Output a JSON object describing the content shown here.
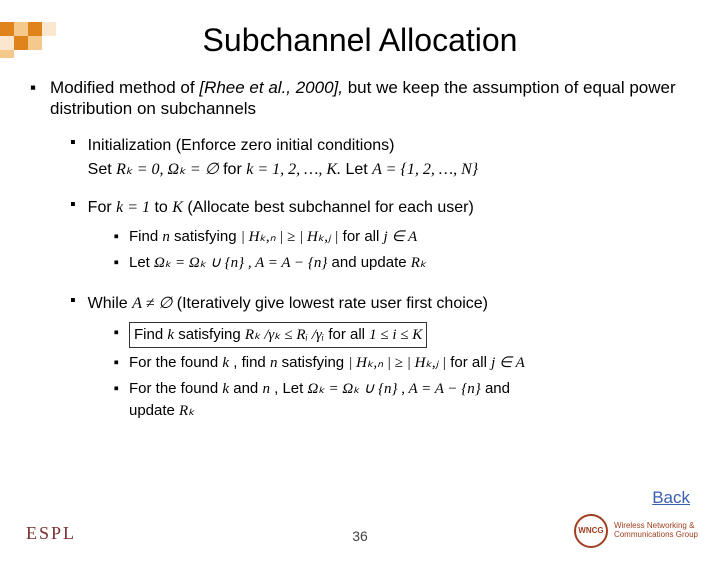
{
  "title": "Subchannel Allocation",
  "intro": {
    "pre": "Modified method of ",
    "cite": "[Rhee et al., 2000],",
    "post": " but we keep the assumption of equal power distribution on subchannels"
  },
  "steps": {
    "init": {
      "head": "Initialization (Enforce zero initial conditions)",
      "set": "Set ",
      "rk0": "Rₖ = 0, ",
      "omega": "Ωₖ = ∅",
      "for_word": " for ",
      "krange": "k = 1, 2, …, K.",
      "let_word": " Let ",
      "aset": "A = {1, 2, …, N}"
    },
    "loop": {
      "for_word": "For ",
      "k1": "k = 1",
      "to": " to ",
      "K": "K",
      "desc": "   (Allocate best subchannel for each user)",
      "find": "Find ",
      "n": "n",
      "sat": " satisfying ",
      "cond": "| Hₖ,ₙ | ≥ | Hₖ,ⱼ |",
      "forall": " for all ",
      "jA": "j ∈ A",
      "let": "Let ",
      "let_expr": "Ωₖ = Ωₖ ∪ {n} ,  A = A − {n}",
      "and_upd": " and update ",
      "Rk": "Rₖ"
    },
    "while": {
      "while_word": "While ",
      "cond": "A ≠ ∅",
      "desc": "   (Iteratively give lowest rate user first choice)",
      "find": "Find ",
      "k": "k",
      "sat": " satisfying ",
      "ratio": "Rₖ /γₖ ≤ Rᵢ /γᵢ",
      "forall": " for all ",
      "range": "1 ≤ i ≤ K",
      "for_found_k": "For the found ",
      "find_n": ", find ",
      "n": "n",
      "sat2": " satisfying ",
      "cond2": "| Hₖ,ₙ | ≥ | Hₖ,ⱼ |",
      "jA": "j ∈ A",
      "for_found2": "For the found ",
      "and": " and ",
      "let2": ", Let ",
      "expr2": "Ωₖ = Ωₖ ∪ {n} , A = A − {n}",
      "and2": " and",
      "update": "update ",
      "Rk": "Rₖ"
    }
  },
  "back": "Back",
  "slidenum": "36",
  "logo_left": "ESPL",
  "logo_right": {
    "circle": "WNCG",
    "line1": "Wireless Networking &",
    "line2": "Communications Group"
  }
}
